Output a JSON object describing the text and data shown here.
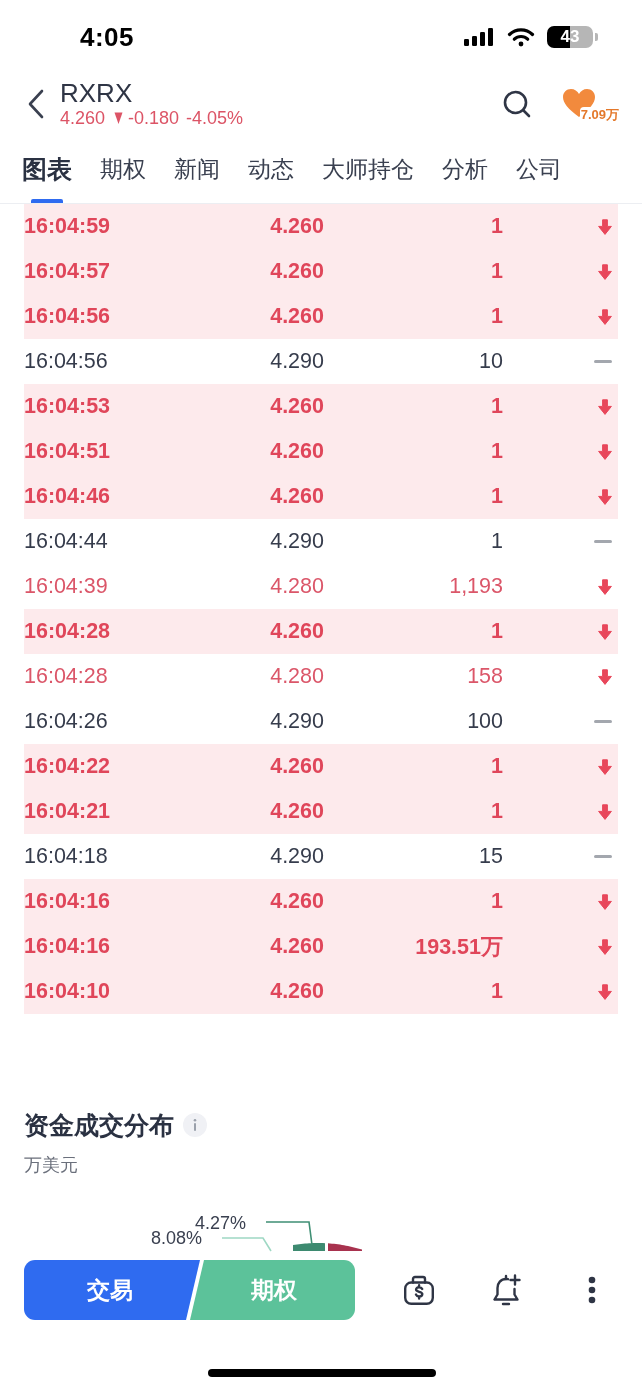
{
  "status_bar": {
    "time": "4:05",
    "battery": "43"
  },
  "header": {
    "symbol": "RXRX",
    "price": "4.260",
    "kind": "down",
    "change": "-0.180",
    "change_percent": "-4.05%",
    "follower_count": "7.09万"
  },
  "tabs": [
    {
      "label": "图表",
      "selected": true
    },
    {
      "label": "期权",
      "selected": false
    },
    {
      "label": "新闻",
      "selected": false
    },
    {
      "label": "动态",
      "selected": false
    },
    {
      "label": "大师持仓",
      "selected": false
    },
    {
      "label": "分析",
      "selected": false
    },
    {
      "label": "公司",
      "selected": false
    }
  ],
  "trades": [
    {
      "time": "16:04:59",
      "price": "4.260",
      "volume": "1",
      "kind": "down",
      "highlighted": true
    },
    {
      "time": "16:04:57",
      "price": "4.260",
      "volume": "1",
      "kind": "down",
      "highlighted": true
    },
    {
      "time": "16:04:56",
      "price": "4.260",
      "volume": "1",
      "kind": "down",
      "highlighted": true
    },
    {
      "time": "16:04:56",
      "price": "4.290",
      "volume": "10",
      "kind": "flat",
      "highlighted": false
    },
    {
      "time": "16:04:53",
      "price": "4.260",
      "volume": "1",
      "kind": "down",
      "highlighted": true
    },
    {
      "time": "16:04:51",
      "price": "4.260",
      "volume": "1",
      "kind": "down",
      "highlighted": true
    },
    {
      "time": "16:04:46",
      "price": "4.260",
      "volume": "1",
      "kind": "down",
      "highlighted": true
    },
    {
      "time": "16:04:44",
      "price": "4.290",
      "volume": "1",
      "kind": "flat",
      "highlighted": false
    },
    {
      "time": "16:04:39",
      "price": "4.280",
      "volume": "1,193",
      "kind": "down",
      "highlighted": false
    },
    {
      "time": "16:04:28",
      "price": "4.260",
      "volume": "1",
      "kind": "down",
      "highlighted": true
    },
    {
      "time": "16:04:28",
      "price": "4.280",
      "volume": "158",
      "kind": "down",
      "highlighted": false
    },
    {
      "time": "16:04:26",
      "price": "4.290",
      "volume": "100",
      "kind": "flat",
      "highlighted": false
    },
    {
      "time": "16:04:22",
      "price": "4.260",
      "volume": "1",
      "kind": "down",
      "highlighted": true
    },
    {
      "time": "16:04:21",
      "price": "4.260",
      "volume": "1",
      "kind": "down",
      "highlighted": true
    },
    {
      "time": "16:04:18",
      "price": "4.290",
      "volume": "15",
      "kind": "flat",
      "highlighted": false
    },
    {
      "time": "16:04:16",
      "price": "4.260",
      "volume": "1",
      "kind": "down",
      "highlighted": true
    },
    {
      "time": "16:04:16",
      "price": "4.260",
      "volume": "193.51万",
      "kind": "down",
      "highlighted": true
    },
    {
      "time": "16:04:10",
      "price": "4.260",
      "volume": "1",
      "kind": "down",
      "highlighted": true
    }
  ],
  "fund_distribution": {
    "title": "资金成交分布",
    "unit": "万美元",
    "slice_labels": [
      "4.27%",
      "8.08%"
    ]
  },
  "bottom_bar": {
    "buttons": [
      {
        "label": "交易",
        "kind": "trade"
      },
      {
        "label": "期权",
        "kind": "options"
      }
    ]
  }
}
